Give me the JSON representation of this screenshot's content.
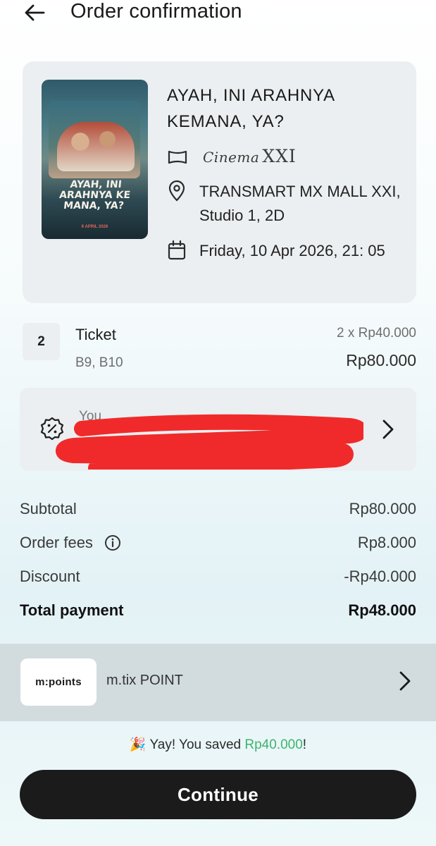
{
  "header": {
    "title": "Order confirmation"
  },
  "movie": {
    "title": "AYAH, INI ARAHNYA KEMANA, YA?",
    "poster_title": "AYAH, INI ARAHNYA KE MANA, YA?",
    "poster_date": "9 APRIL 2026",
    "cinema_brand_script": "Cinema",
    "cinema_brand_mark": "XXI",
    "location": "TRANSMART MX MALL XXI, Studio 1, 2D",
    "datetime": "Friday, 10 Apr 2026, 21: 05"
  },
  "ticket": {
    "quantity": "2",
    "label": "Ticket",
    "seats": "B9, B10",
    "unit_price": "2 x Rp40.000",
    "total": "Rp80.000"
  },
  "voucher": {
    "text_prefix": "You"
  },
  "summary": {
    "subtotal_label": "Subtotal",
    "subtotal_value": "Rp80.000",
    "fees_label": "Order fees",
    "fees_value": "Rp8.000",
    "discount_label": "Discount",
    "discount_value": "-Rp40.000",
    "total_label": "Total payment",
    "total_value": "Rp48.000"
  },
  "points": {
    "logo": "m:points",
    "label": "m.tix POINT"
  },
  "savings": {
    "emoji": "🎉",
    "prefix": "Yay! You saved ",
    "amount": "Rp40.000",
    "suffix": "!"
  },
  "cta": {
    "continue_label": "Continue"
  },
  "colors": {
    "accent_green": "#3fb36f",
    "button_dark": "#1b1b1b",
    "redaction": "#f02a2a"
  }
}
